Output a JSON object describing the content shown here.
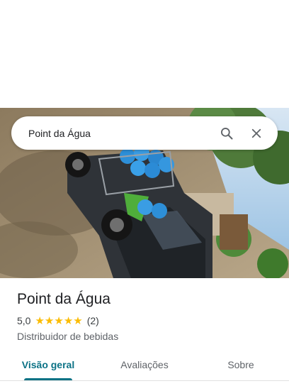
{
  "search": {
    "query": "Point da Água",
    "search_icon": "search-icon",
    "clear_icon": "close-icon"
  },
  "place": {
    "name": "Point da Água",
    "rating": "5,0",
    "stars": 5,
    "review_count": "(2)",
    "category": "Distribuidor de bebidas",
    "photo": "photo-of-vehicle-with-water-jugs"
  },
  "tabs": [
    {
      "label": "Visão geral",
      "active": true
    },
    {
      "label": "Avaliações",
      "active": false
    },
    {
      "label": "Sobre",
      "active": false
    }
  ],
  "colors": {
    "accent": "#0b7285",
    "star": "#fbbc04",
    "text": "#202124"
  }
}
